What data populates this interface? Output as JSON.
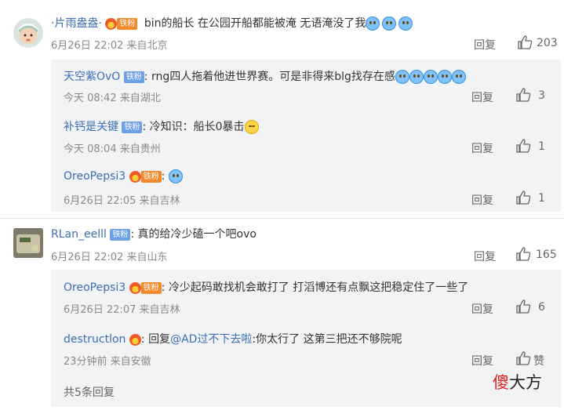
{
  "comments": [
    {
      "user": "·片雨盎盎·",
      "badge": "铁粉",
      "text": "bin的船长 在公园开船都能被淹 无语淹没了我",
      "time": "6月26日 22:02 来自北京",
      "reply_label": "回复",
      "likes": "203",
      "replies": [
        {
          "user": "天空紫OvO",
          "badge": "铁粉",
          "text": "rng四人拖着他进世界赛。可是非得来blg找存在感",
          "time": "今天 08:42 来自湖北",
          "reply_label": "回复",
          "likes": "3"
        },
        {
          "user": "补钙是关键",
          "badge": "铁粉",
          "text": "冷知识：船长0暴击",
          "time": "今天 08:04 来自贵州",
          "reply_label": "回复",
          "likes": "1"
        },
        {
          "user": "OreoPepsi3",
          "badge": "铁粉",
          "text": "",
          "time": "6月26日 22:05 来自吉林",
          "reply_label": "回复",
          "likes": "1"
        }
      ]
    },
    {
      "user": "RLan_eelll",
      "badge": "铁粉",
      "text": "真的给冷少磕一个吧ovo",
      "time": "6月26日 22:02 来自山东",
      "reply_label": "回复",
      "likes": "165",
      "replies": [
        {
          "user": "OreoPepsi3",
          "badge": "铁粉",
          "text": "冷少起码敢找机会敢打了 打滔博还有点飘这把稳定住了一些了",
          "time": "6月26日 22:07 来自吉林",
          "reply_label": "回复",
          "likes": "6"
        },
        {
          "user": "destructlon",
          "text_prefix": "回复",
          "mention": "@AD过不下去啦",
          "text": ":你太行了 这第三把还不够院呢",
          "time": "23分钟前 来自安徽",
          "reply_label": "回复",
          "likes": "赞"
        }
      ],
      "more_replies": "共5条回复"
    }
  ],
  "watermark": {
    "part1": "傻",
    "part2": "大方"
  },
  "colors": {
    "username": "#3a6fb5",
    "meta": "#8a8a8a",
    "reply_bg": "#f2f3f5",
    "badge_blue": "#6ea0e6",
    "watermark_red": "#e0201a"
  }
}
